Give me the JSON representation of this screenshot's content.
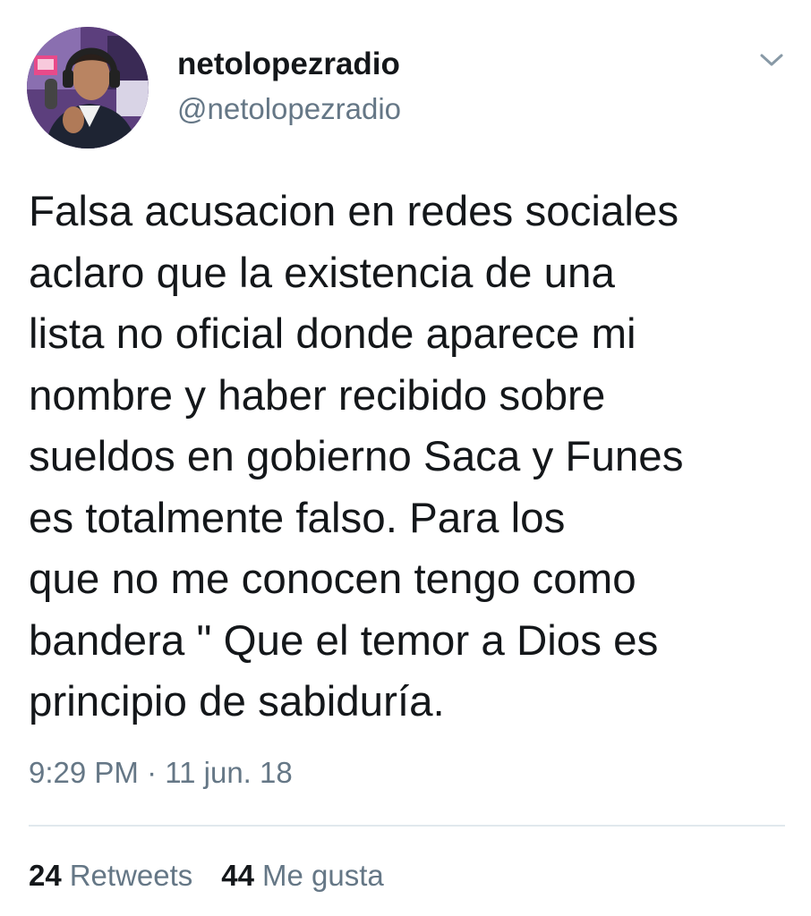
{
  "user": {
    "display_name": "netolopezradio",
    "handle": "@netolopezradio",
    "avatar_icon": "profile-photo-man-with-headphones-radio-studio"
  },
  "menu": {
    "icon": "chevron-down-icon"
  },
  "tweet": {
    "text": "Falsa acusacion en redes sociales\naclaro que la existencia de una\nlista no oficial donde aparece mi\nnombre y haber recibido sobre\nsueldos en gobierno Saca y Funes\nes totalmente falso. Para los\nque no me conocen  tengo como\nbandera \" Que el temor a Dios es\nprincipio de sabiduría.",
    "timestamp": "9:29 PM · 11 jun. 18"
  },
  "stats": {
    "retweets_count": "24",
    "retweets_label": "Retweets",
    "likes_count": "44",
    "likes_label": "Me gusta"
  },
  "colors": {
    "text_primary": "#14171a",
    "text_secondary": "#657786",
    "divider": "#e1e8ed",
    "background": "#ffffff"
  }
}
